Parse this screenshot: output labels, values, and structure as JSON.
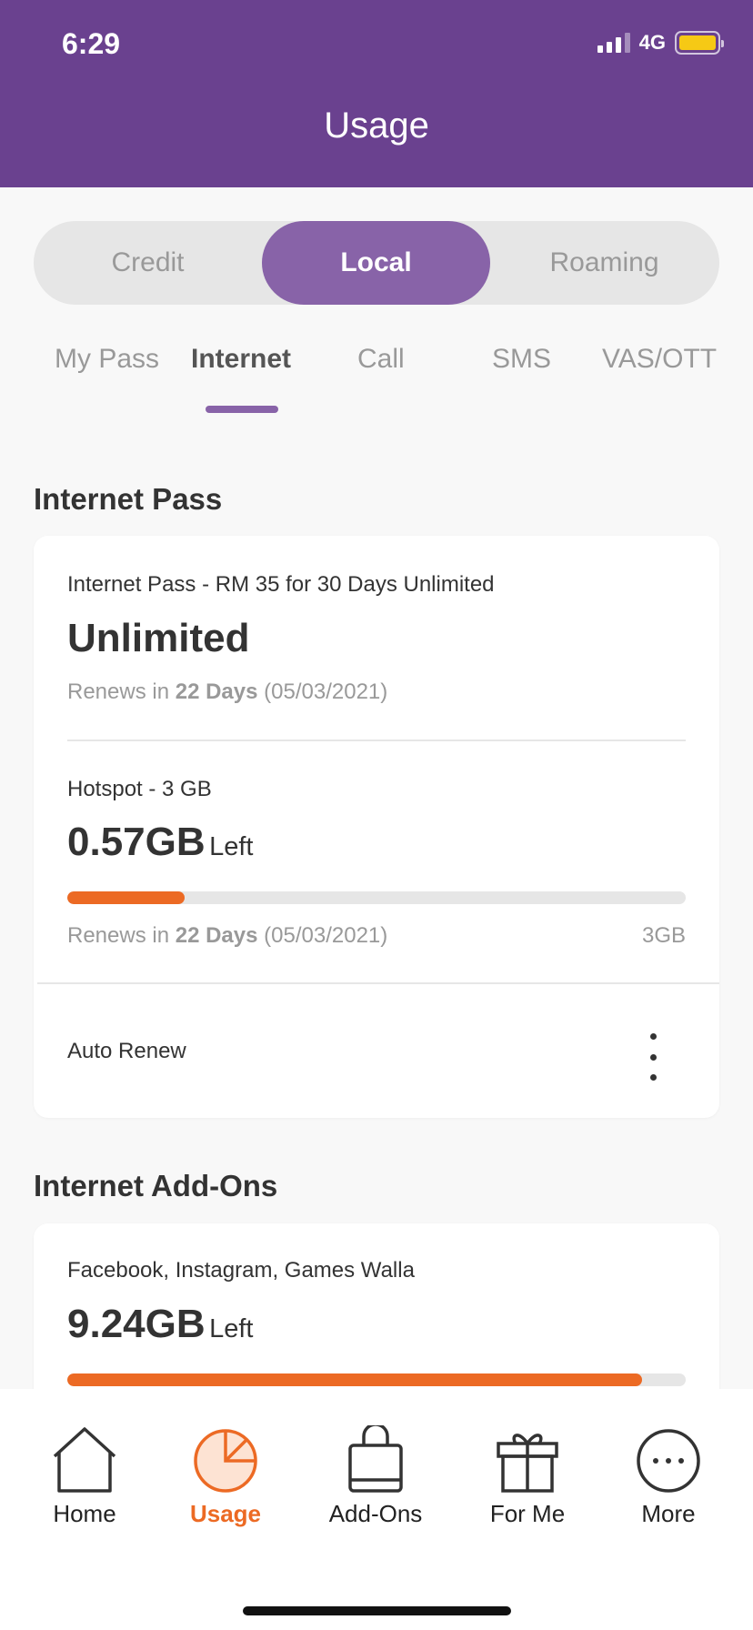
{
  "status_bar": {
    "time": "6:29",
    "network": "4G"
  },
  "header": {
    "title": "Usage"
  },
  "segments": [
    {
      "label": "Credit",
      "active": false
    },
    {
      "label": "Local",
      "active": true
    },
    {
      "label": "Roaming",
      "active": false
    }
  ],
  "tabs": [
    {
      "label": "My Pass",
      "active": false
    },
    {
      "label": "Internet",
      "active": true
    },
    {
      "label": "Call",
      "active": false
    },
    {
      "label": "SMS",
      "active": false
    },
    {
      "label": "VAS/OTT",
      "active": false
    }
  ],
  "internet_pass": {
    "section_title": "Internet Pass",
    "plan": {
      "name": "Internet Pass -  RM 35 for 30 Days Unlimited",
      "amount": "Unlimited",
      "renew_prefix": "Renews in",
      "renew_days": "22 Days",
      "renew_date": "(05/03/2021)"
    },
    "hotspot": {
      "name": "Hotspot -  3 GB",
      "amount": "0.57GB",
      "left_label": "Left",
      "progress": 0.19,
      "renew_prefix": "Renews in",
      "renew_days": "22 Days",
      "renew_date": "(05/03/2021)",
      "total": "3GB"
    },
    "auto_renew_label": "Auto Renew"
  },
  "addons": {
    "section_title": "Internet Add-Ons",
    "item": {
      "name": "Facebook, Instagram, Games Walla",
      "amount": "9.24GB",
      "left_label": "Left",
      "progress": 0.93
    }
  },
  "bottom_nav": [
    {
      "label": "Home",
      "icon": "home-icon",
      "active": false
    },
    {
      "label": "Usage",
      "icon": "pie-chart-icon",
      "active": true
    },
    {
      "label": "Add-Ons",
      "icon": "shopping-bag-icon",
      "active": false
    },
    {
      "label": "For Me",
      "icon": "gift-icon",
      "active": false
    },
    {
      "label": "More",
      "icon": "more-icon",
      "active": false
    }
  ],
  "colors": {
    "brand_purple": "#6a418f",
    "accent_purple": "#8863a8",
    "accent_orange": "#ec6a24"
  }
}
